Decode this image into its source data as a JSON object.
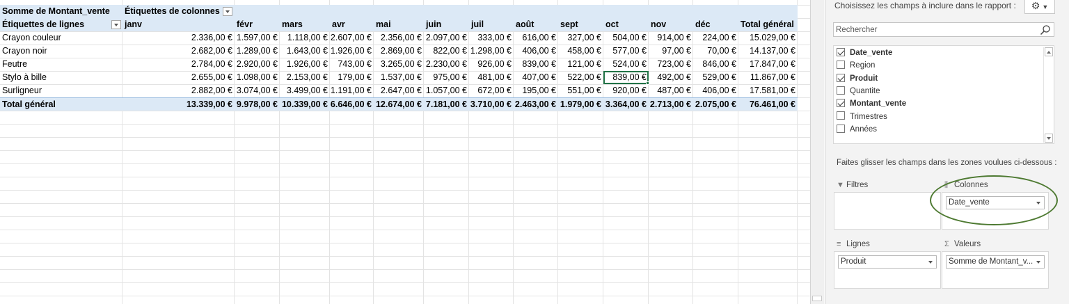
{
  "pivot": {
    "corner_label": "Somme de Montant_vente",
    "columns_label": "Étiquettes de colonnes",
    "rows_label": "Étiquettes de lignes",
    "months": [
      "janv",
      "févr",
      "mars",
      "avr",
      "mai",
      "juin",
      "juil",
      "août",
      "sept",
      "oct",
      "nov",
      "déc"
    ],
    "total_header": "Total général",
    "rows": [
      {
        "label": "Crayon couleur",
        "values": [
          "2.336,00 €",
          "1.597,00 €",
          "1.118,00 €",
          "2.607,00 €",
          "2.356,00 €",
          "2.097,00 €",
          "333,00 €",
          "616,00 €",
          "327,00 €",
          "504,00 €",
          "914,00 €",
          "224,00 €"
        ],
        "total": "15.029,00 €"
      },
      {
        "label": "Crayon noir",
        "values": [
          "2.682,00 €",
          "1.289,00 €",
          "1.643,00 €",
          "1.926,00 €",
          "2.869,00 €",
          "822,00 €",
          "1.298,00 €",
          "406,00 €",
          "458,00 €",
          "577,00 €",
          "97,00 €",
          "70,00 €"
        ],
        "total": "14.137,00 €"
      },
      {
        "label": "Feutre",
        "values": [
          "2.784,00 €",
          "2.920,00 €",
          "1.926,00 €",
          "743,00 €",
          "3.265,00 €",
          "2.230,00 €",
          "926,00 €",
          "839,00 €",
          "121,00 €",
          "524,00 €",
          "723,00 €",
          "846,00 €"
        ],
        "total": "17.847,00 €"
      },
      {
        "label": "Stylo à bille",
        "values": [
          "2.655,00 €",
          "1.098,00 €",
          "2.153,00 €",
          "179,00 €",
          "1.537,00 €",
          "975,00 €",
          "481,00 €",
          "407,00 €",
          "522,00 €",
          "839,00 €",
          "492,00 €",
          "529,00 €"
        ],
        "total": "11.867,00 €"
      },
      {
        "label": "Surligneur",
        "values": [
          "2.882,00 €",
          "3.074,00 €",
          "3.499,00 €",
          "1.191,00 €",
          "2.647,00 €",
          "1.057,00 €",
          "672,00 €",
          "195,00 €",
          "551,00 €",
          "920,00 €",
          "487,00 €",
          "406,00 €"
        ],
        "total": "17.581,00 €"
      }
    ],
    "grand_total": {
      "label": "Total général",
      "values": [
        "13.339,00 €",
        "9.978,00 €",
        "10.339,00 €",
        "6.646,00 €",
        "12.674,00 €",
        "7.181,00 €",
        "3.710,00 €",
        "2.463,00 €",
        "1.979,00 €",
        "3.364,00 €",
        "2.713,00 €",
        "2.075,00 €"
      ],
      "total": "76.461,00 €"
    },
    "selected_cell": {
      "row": 3,
      "month_index": 9
    },
    "accent_color": "#dce9f6",
    "selection_color": "#217346"
  },
  "field_pane": {
    "choose_label": "Choisissez les champs à inclure dans le rapport :",
    "settings_icon": "gear-icon",
    "search_placeholder": "Rechercher",
    "fields": [
      {
        "name": "Date_vente",
        "checked": true
      },
      {
        "name": "Region",
        "checked": false
      },
      {
        "name": "Produit",
        "checked": true
      },
      {
        "name": "Quantite",
        "checked": false
      },
      {
        "name": "Montant_vente",
        "checked": true
      },
      {
        "name": "Trimestres",
        "checked": false
      },
      {
        "name": "Années",
        "checked": false
      }
    ],
    "drag_hint": "Faites glisser les champs dans les zones voulues ci-dessous :",
    "areas": {
      "filters": {
        "label": "Filtres",
        "items": []
      },
      "columns": {
        "label": "Colonnes",
        "items": [
          "Date_vente"
        ]
      },
      "rows": {
        "label": "Lignes",
        "items": [
          "Produit"
        ]
      },
      "values": {
        "label": "Valeurs",
        "items": [
          "Somme de Montant_v..."
        ]
      }
    },
    "annotation_color": "#4e7a32"
  }
}
